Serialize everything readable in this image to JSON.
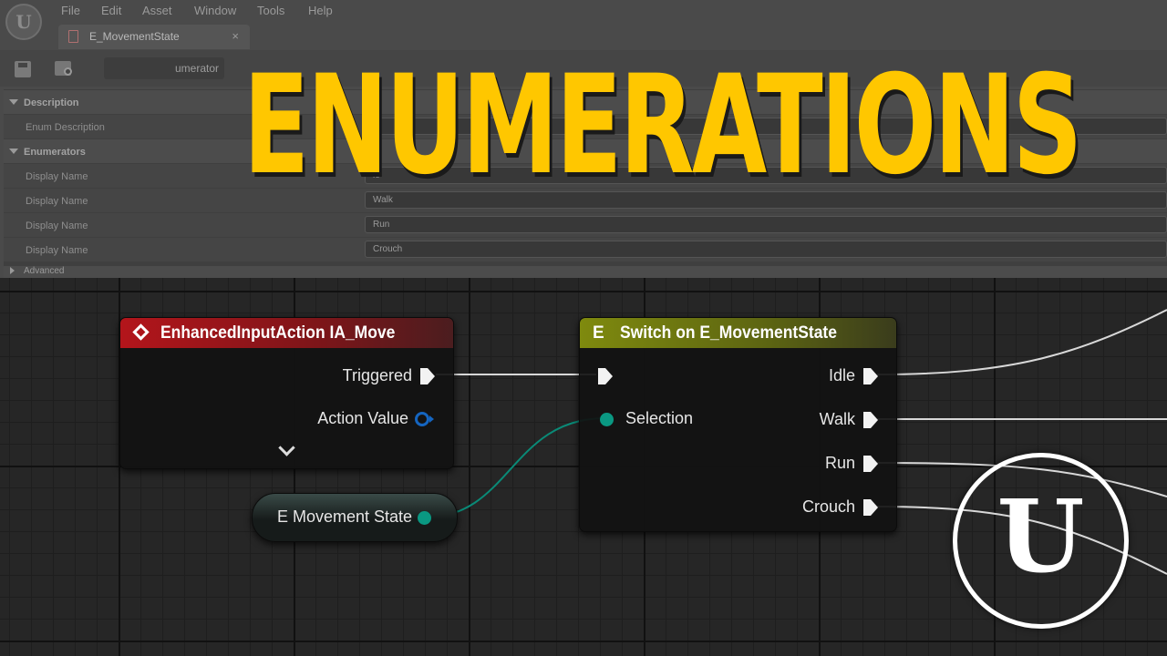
{
  "app": {
    "menu": [
      "File",
      "Edit",
      "Asset",
      "Window",
      "Tools",
      "Help"
    ],
    "tab_title": "E_MovementState",
    "tab_close": "×",
    "toolbar_button_label": "umerator"
  },
  "details": {
    "description_header": "Description",
    "enum_description_label": "Enum Description",
    "enumerators_header": "Enumerators",
    "enumerators": [
      {
        "label": "Display Name",
        "value": "le"
      },
      {
        "label": "Display Name",
        "value": "Walk"
      },
      {
        "label": "Display Name",
        "value": "Run"
      },
      {
        "label": "Display Name",
        "value": "Crouch"
      }
    ],
    "advanced_label": "Advanced"
  },
  "title": "ENUMERATIONS",
  "graph": {
    "input_node": {
      "title": "EnhancedInputAction IA_Move",
      "pins": {
        "triggered": "Triggered",
        "action_value": "Action Value"
      }
    },
    "switch_node": {
      "title": "Switch on E_MovementState",
      "icon": "E",
      "selection_label": "Selection",
      "outputs": [
        "Idle",
        "Walk",
        "Run",
        "Crouch"
      ]
    },
    "variable_node": {
      "label": "E Movement State"
    },
    "colors": {
      "event_header": "#b3151b",
      "switch_header": "#7f8a0e",
      "enum_pin": "#0a9882",
      "vector_pin": "#1565c0",
      "title": "#ffc700"
    }
  },
  "logo": {
    "glyph": "U"
  }
}
